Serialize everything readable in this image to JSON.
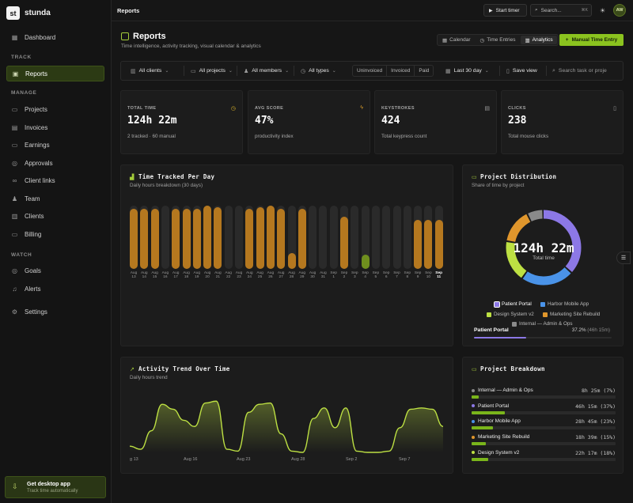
{
  "app": {
    "brand_mark": "st",
    "brand_name": "stunda"
  },
  "sidebar": {
    "dashboard": "Dashboard",
    "section_track": "TRACK",
    "reports": "Reports",
    "section_manage": "MANAGE",
    "manage_items": [
      {
        "label": "Projects",
        "icon": "folder-icon"
      },
      {
        "label": "Invoices",
        "icon": "invoice-icon"
      },
      {
        "label": "Earnings",
        "icon": "wallet-icon"
      },
      {
        "label": "Approvals",
        "icon": "check-circle-icon"
      },
      {
        "label": "Client links",
        "icon": "link-icon"
      },
      {
        "label": "Team",
        "icon": "team-icon"
      },
      {
        "label": "Clients",
        "icon": "building-icon"
      },
      {
        "label": "Billing",
        "icon": "card-icon"
      }
    ],
    "section_watch": "WATCH",
    "watch_items": [
      {
        "label": "Goals",
        "icon": "target-icon"
      },
      {
        "label": "Alerts",
        "icon": "bell-icon"
      }
    ],
    "settings": "Settings",
    "desktop_title": "Get desktop app",
    "desktop_sub": "Track time automatically"
  },
  "topbar": {
    "breadcrumb": "Reports",
    "start_timer": "Start timer",
    "search_placeholder": "Search...",
    "search_kbd": "⌘K",
    "avatar": "AW"
  },
  "header": {
    "title": "Reports",
    "subtitle": "Time intelligence, activity tracking, visual calendar & analytics",
    "tabs": [
      "Calendar",
      "Time Entries",
      "Analytics"
    ],
    "active_tab": "Analytics",
    "manual_entry": "Manual Time Entry"
  },
  "filters": {
    "clients": "All clients",
    "projects": "All projects",
    "members": "All members",
    "types": "All types",
    "invoice_states": [
      "Uninvoiced",
      "Invoiced",
      "Paid"
    ],
    "range": "Last 30 day",
    "save_view": "Save view",
    "search_placeholder": "Search task or proje"
  },
  "stats": [
    {
      "label": "TOTAL TIME",
      "value": "124h 22m",
      "sub": "2 tracked · 60 manual",
      "icon": "clock-icon",
      "color": "#d6b02a"
    },
    {
      "label": "AVG SCORE",
      "value": "47%",
      "sub": "productivity index",
      "icon": "bolt-icon",
      "color": "#d69a2a"
    },
    {
      "label": "KEYSTROKES",
      "value": "424",
      "sub": "Total keypress count",
      "icon": "keyboard-icon",
      "color": "#9a9a9a"
    },
    {
      "label": "CLICKS",
      "value": "238",
      "sub": "Total mouse clicks",
      "icon": "mouse-icon",
      "color": "#9a9a9a"
    }
  ],
  "time_per_day": {
    "title": "Time Tracked Per Day",
    "subtitle": "Daily hours breakdown (30 days)",
    "chart_data": {
      "type": "bar",
      "categories": [
        "Aug 13",
        "Aug 14",
        "Aug 15",
        "Aug 16",
        "Aug 17",
        "Aug 18",
        "Aug 19",
        "Aug 20",
        "Aug 21",
        "Aug 22",
        "Aug 23",
        "Aug 24",
        "Aug 25",
        "Aug 26",
        "Aug 27",
        "Aug 28",
        "Aug 29",
        "Aug 30",
        "Aug 31",
        "Sep 1",
        "Sep 2",
        "Sep 3",
        "Sep 4",
        "Sep 5",
        "Sep 6",
        "Sep 7",
        "Sep 8",
        "Sep 9",
        "Sep 10",
        "Sep 11"
      ],
      "values": [
        0.95,
        0.95,
        0.95,
        0,
        0.95,
        0.95,
        0.95,
        1.0,
        0.97,
        0,
        0,
        0.95,
        0.97,
        1.0,
        0.95,
        0.25,
        0.95,
        0,
        0,
        0,
        0.83,
        0,
        0.22,
        0,
        0,
        0,
        0,
        0.77,
        0.77,
        0.77,
        0.35
      ],
      "highlight_index": 22,
      "active_category": "Sep 11",
      "bar_color": "#b5781f",
      "highlight_color": "#6f8f1e",
      "track_color": "#2a2a2a"
    }
  },
  "distribution": {
    "title": "Project Distribution",
    "subtitle": "Share of time by project",
    "center_value": "124h 22m",
    "center_label": "Total time",
    "chart_data": {
      "type": "pie",
      "labels": [
        "Patient Portal",
        "Harbor Mobile App",
        "Design System v2",
        "Marketing Site Rebuild",
        "Internal — Admin & Ops"
      ],
      "values": [
        37,
        23,
        18,
        15,
        7
      ],
      "colors": [
        "#8c78e6",
        "#4a93e8",
        "#bde043",
        "#e0962c",
        "#8a8a8a"
      ]
    },
    "selected_name": "Patient Portal",
    "selected_value": "37.2%",
    "selected_hours": "(46h 15m)",
    "selected_fraction": 0.372
  },
  "trend": {
    "title": "Activity Trend Over Time",
    "subtitle": "Daily hours trend",
    "chart_data": {
      "type": "area",
      "x_ticks": [
        "g 13",
        "Aug 16",
        "Aug 23",
        "Aug 28",
        "Sep 2",
        "Sep 7"
      ],
      "y": [
        0.1,
        0.05,
        0.35,
        0.78,
        0.7,
        0.52,
        0.42,
        0.8,
        0.83,
        0.05,
        0.02,
        0.65,
        0.78,
        0.8,
        0.3,
        0.02,
        0.0,
        0.55,
        0.72,
        0.4,
        0.72,
        0.02,
        0.0,
        0.0,
        0.02,
        0.4,
        0.7,
        0.72,
        0.7,
        0.42
      ],
      "color": "#bde043"
    }
  },
  "breakdown": {
    "title": "Project Breakdown",
    "items": [
      {
        "name": "Internal — Admin & Ops",
        "value": "8h 25m (7%)",
        "share": 0.07,
        "dot": "#8a8a8a"
      },
      {
        "name": "Patient Portal",
        "value": "46h 15m (37%)",
        "share": 0.37,
        "dot": "#8c78e6"
      },
      {
        "name": "Harbor Mobile App",
        "value": "28h 45m (23%)",
        "share": 0.23,
        "dot": "#4a93e8"
      },
      {
        "name": "Marketing Site Rebuild",
        "value": "18h 39m (15%)",
        "share": 0.15,
        "dot": "#e0962c"
      },
      {
        "name": "Design System v2",
        "value": "22h 17m (18%)",
        "share": 0.18,
        "dot": "#bde043"
      }
    ]
  }
}
